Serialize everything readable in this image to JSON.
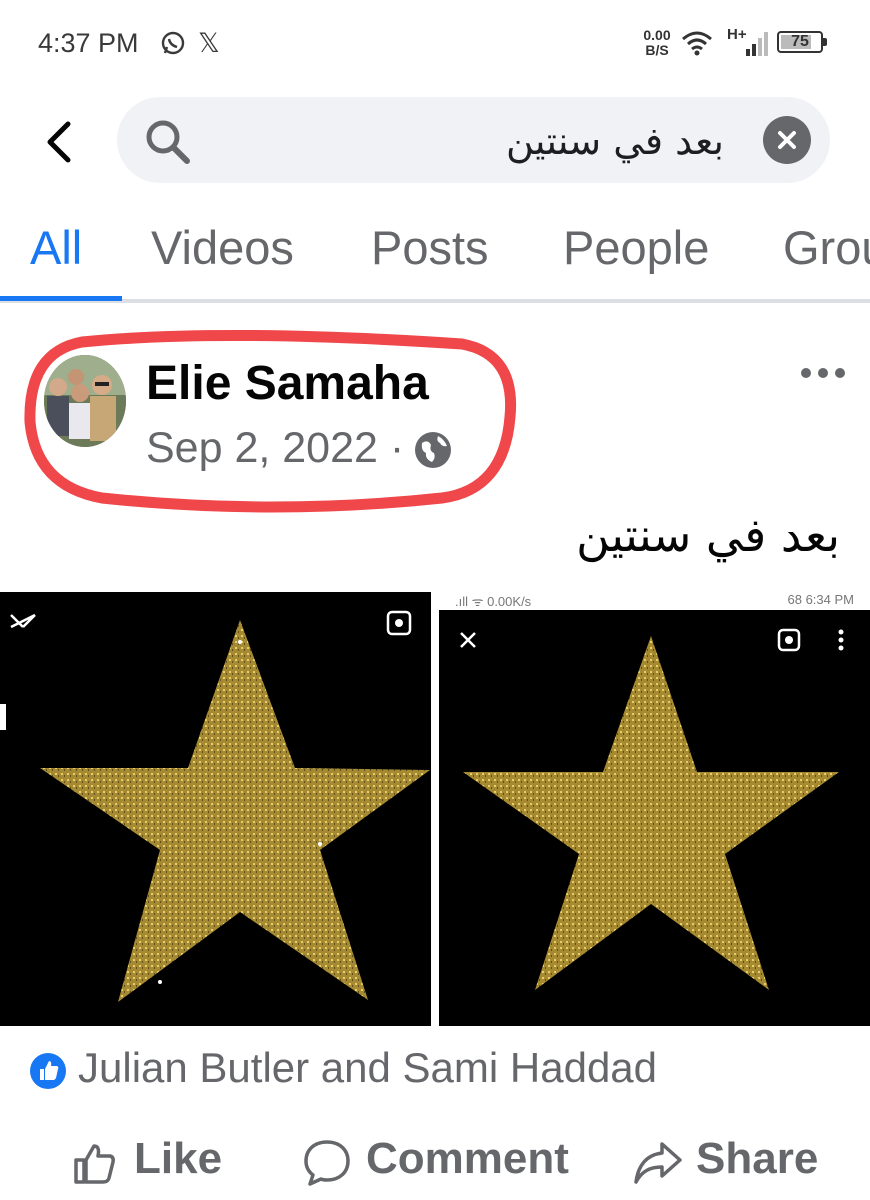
{
  "status_bar": {
    "time": "4:37 PM",
    "network_speed_value": "0.00",
    "network_speed_unit": "B/S",
    "network_type": "H+",
    "battery_level": "75",
    "icons": [
      "whatsapp-icon",
      "x-icon",
      "wifi-icon",
      "signal-icon",
      "battery-icon"
    ]
  },
  "search": {
    "query": "بعد في سنتين"
  },
  "tabs": [
    {
      "label": "All",
      "active": true
    },
    {
      "label": "Videos",
      "active": false
    },
    {
      "label": "Posts",
      "active": false
    },
    {
      "label": "People",
      "active": false
    },
    {
      "label": "Grou",
      "active": false
    }
  ],
  "post": {
    "author": "Elie Samaha",
    "date": "Sep 2, 2022 ·",
    "privacy_icon": "globe-icon",
    "caption": "بعد في سنتين",
    "image_right_status": {
      "left": ".ıll ᯤ 0.00K/s",
      "right": "68 6:34 PM"
    },
    "reactions": "Julian Butler and Sami Haddad"
  },
  "actions": {
    "like": "Like",
    "comment": "Comment",
    "share": "Share"
  },
  "colors": {
    "accent": "#1877f2",
    "highlight_circle": "#f0474a",
    "secondary_text": "#65676b",
    "star_gold": "#b79a3c"
  }
}
